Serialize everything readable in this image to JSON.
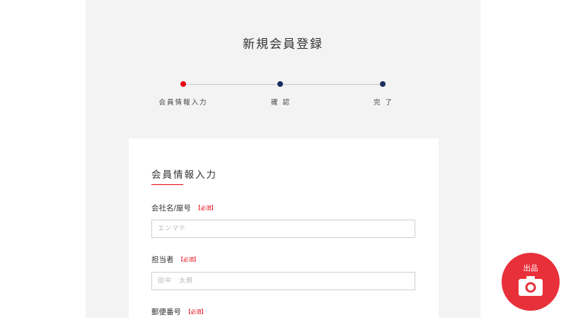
{
  "page": {
    "title": "新規会員登録"
  },
  "steps": [
    {
      "label": "会員情報入力",
      "active": true
    },
    {
      "label": "確 認",
      "active": false
    },
    {
      "label": "完 了",
      "active": false
    }
  ],
  "colors": {
    "accent_red": "#e60012",
    "step_inactive": "#1c2e5f",
    "fab": "#e8303a",
    "page_bg": "#f3f3f3"
  },
  "form": {
    "section_title": "会員情報入力",
    "required_mark": "【必須】",
    "fields": [
      {
        "label": "会社名/屋号",
        "placeholder": "エンマテ"
      },
      {
        "label": "担当者",
        "placeholder": "田中　太朗"
      },
      {
        "label": "郵便番号"
      }
    ]
  },
  "fab": {
    "label": "出品",
    "icon": "camera-icon"
  }
}
